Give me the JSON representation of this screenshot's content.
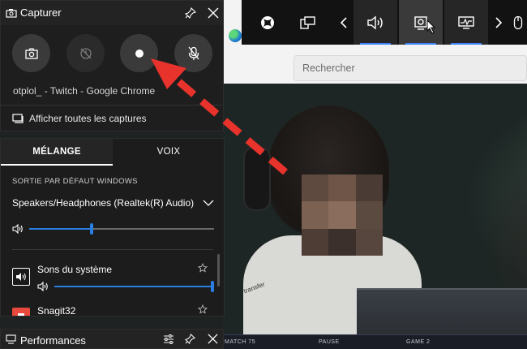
{
  "browser": {
    "search_placeholder": "Rechercher"
  },
  "stream": {
    "shirt_text": "transfer",
    "bottom_bar": [
      "MATCH 75",
      "PAUSE",
      "GAME 2"
    ]
  },
  "xbox_bar": {
    "buttons": [
      {
        "icon": "xbox-logo-icon"
      },
      {
        "icon": "widget-menu-icon"
      },
      {
        "icon": "chevron-left-icon"
      },
      {
        "icon": "audio-icon",
        "active": true
      },
      {
        "icon": "capture-icon",
        "active": true
      },
      {
        "icon": "performance-icon",
        "active": true
      },
      {
        "icon": "chevron-right-icon"
      },
      {
        "icon": "mouse-icon"
      }
    ]
  },
  "capture_widget": {
    "title": "Capturer",
    "buttons": [
      {
        "icon": "camera-icon",
        "label": "Screenshot"
      },
      {
        "icon": "record-last-30s-icon",
        "label": "Record last 30 seconds",
        "disabled": true
      },
      {
        "icon": "record-icon",
        "label": "Start recording"
      },
      {
        "icon": "mic-muted-icon",
        "label": "Microphone off"
      }
    ],
    "source_label": "otplol_ - Twitch - Google Chrome",
    "show_all_label": "Afficher toutes les captures"
  },
  "audio_widget": {
    "tabs": [
      {
        "label": "MÉLANGE",
        "selected": true
      },
      {
        "label": "VOIX",
        "selected": false
      }
    ],
    "section_heading": "SORTIE PAR DÉFAUT WINDOWS",
    "default_device": "Speakers/Headphones (Realtek(R) Audio)",
    "master_volume": 0.33,
    "apps": [
      {
        "name": "Sons du système",
        "volume": 1.0
      },
      {
        "name": "Snagit32"
      }
    ]
  },
  "performance_widget": {
    "title": "Performances"
  },
  "colors": {
    "accent": "#2a7de1",
    "annotation_red": "#e8322c"
  }
}
